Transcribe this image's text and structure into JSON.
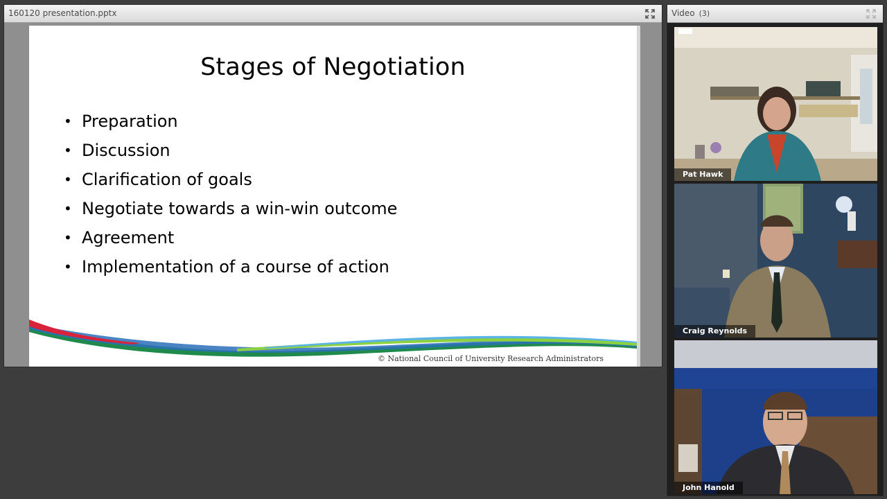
{
  "share_pod": {
    "title": "160120 presentation.pptx",
    "maximize_icon": "expand-arrows-icon"
  },
  "slide": {
    "title": "Stages of Negotiation",
    "bullets": [
      "Preparation",
      "Discussion",
      "Clarification of goals",
      "Negotiate towards a win-win outcome",
      "Agreement",
      "Implementation of a course of action"
    ],
    "copyright": "© National Council of University Research Administrators"
  },
  "video_pod": {
    "title": "Video",
    "count": "(3)",
    "maximize_icon": "expand-arrows-icon",
    "participants": [
      {
        "name": "Pat Hawk"
      },
      {
        "name": "Craig Reynolds"
      },
      {
        "name": "John Hanold"
      }
    ]
  },
  "colors": {
    "background": "#3d3d3d",
    "swoosh_red": "#d9233b",
    "swoosh_green": "#1f8a4c",
    "swoosh_blue": "#2a6fb8",
    "swoosh_light_green": "#8cd13f"
  }
}
